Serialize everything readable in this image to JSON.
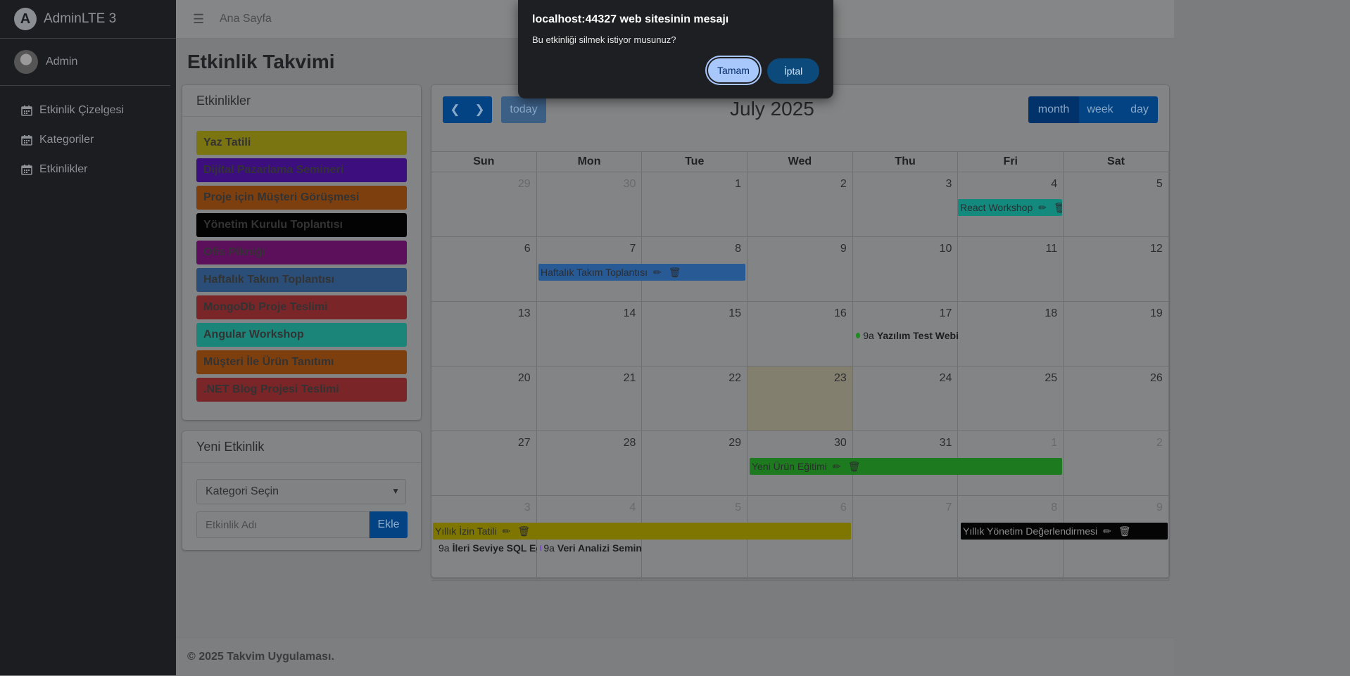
{
  "sidebar": {
    "brand": "AdminLTE 3",
    "user": "Admin",
    "items": [
      {
        "label": "Etkinlik Çizelgesi",
        "icon": "calendar-icon"
      },
      {
        "label": "Kategoriler",
        "icon": "calendar-icon"
      },
      {
        "label": "Etkinlikler",
        "icon": "calendar-icon"
      }
    ]
  },
  "topbar": {
    "home_link": "Ana Sayfa"
  },
  "page_title": "Etkinlik Takvimi",
  "events_panel": {
    "title": "Etkinlikler",
    "items": [
      {
        "label": "Yaz Tatili",
        "color": "#7a7411"
      },
      {
        "label": "Dijital Pazarlama Semineri",
        "color": "#3c0e7e"
      },
      {
        "label": "Proje için Müşteri Görüşmesi",
        "color": "#7e3f0f"
      },
      {
        "label": "Yönetim Kurulu Toplantısı",
        "color": "#030303"
      },
      {
        "label": "Ofis Pikniği",
        "color": "#5c105c"
      },
      {
        "label": "Haftalık Takım Toplantısı",
        "color": "#2a4e78"
      },
      {
        "label": "MongoDb Proje Teslimi",
        "color": "#7a2528"
      },
      {
        "label": "Angular Workshop",
        "color": "#1c857a"
      },
      {
        "label": "Müşteri İle Ürün Tanıtımı",
        "color": "#7e3f0f"
      },
      {
        "label": ".NET Blog Projesi Teslimi",
        "color": "#7a2528"
      }
    ]
  },
  "new_event": {
    "title": "Yeni Etkinlik",
    "category_placeholder": "Kategori Seçin",
    "name_placeholder": "Etkinlik Adı",
    "add_label": "Ekle"
  },
  "calendar": {
    "title": "July 2025",
    "today_label": "today",
    "views": {
      "month": "month",
      "week": "week",
      "day": "day"
    },
    "days_of_week": [
      "Sun",
      "Mon",
      "Tue",
      "Wed",
      "Thu",
      "Fri",
      "Sat"
    ],
    "weeks": [
      [
        {
          "d": "29",
          "o": true
        },
        {
          "d": "30",
          "o": true
        },
        {
          "d": "1"
        },
        {
          "d": "2"
        },
        {
          "d": "3"
        },
        {
          "d": "4"
        },
        {
          "d": "5"
        }
      ],
      [
        {
          "d": "6"
        },
        {
          "d": "7"
        },
        {
          "d": "8"
        },
        {
          "d": "9"
        },
        {
          "d": "10"
        },
        {
          "d": "11"
        },
        {
          "d": "12"
        }
      ],
      [
        {
          "d": "13"
        },
        {
          "d": "14"
        },
        {
          "d": "15"
        },
        {
          "d": "16"
        },
        {
          "d": "17"
        },
        {
          "d": "18"
        },
        {
          "d": "19"
        }
      ],
      [
        {
          "d": "20"
        },
        {
          "d": "21"
        },
        {
          "d": "22"
        },
        {
          "d": "23",
          "today": true
        },
        {
          "d": "24"
        },
        {
          "d": "25"
        },
        {
          "d": "26"
        }
      ],
      [
        {
          "d": "27"
        },
        {
          "d": "28"
        },
        {
          "d": "29"
        },
        {
          "d": "30"
        },
        {
          "d": "31"
        },
        {
          "d": "1",
          "o": true
        },
        {
          "d": "2",
          "o": true
        }
      ],
      [
        {
          "d": "3",
          "o": true
        },
        {
          "d": "4",
          "o": true
        },
        {
          "d": "5",
          "o": true
        },
        {
          "d": "6",
          "o": true
        },
        {
          "d": "7",
          "o": true
        },
        {
          "d": "8",
          "o": true
        },
        {
          "d": "9",
          "o": true
        }
      ]
    ],
    "events": {
      "react": "React Workshop",
      "weekly": "Haftalık Takım Toplantısı",
      "test_time": "9a",
      "test": "Yazılım Test Webi",
      "product": "Yeni Ürün Eğitimi",
      "annual_leave": "Yıllık İzin Tatili",
      "review": "Yıllık Yönetim Değerlendirmesi",
      "sql_time": "9a",
      "sql": "İleri Seviye SQL Eğ",
      "data_time": "9a",
      "data": "Veri Analizi Semin"
    },
    "colors": {
      "react": "#148a7e",
      "weekly": "#285a95",
      "product": "#1e7a1e",
      "annual_leave": "#7e7600",
      "review": "#050505",
      "test_dot": "#1f8a1f",
      "sql_dot": "#1f8a1f",
      "data_dot": "#5b2aa8"
    }
  },
  "footer": "© 2025 Takvim Uygulaması.",
  "dialog": {
    "title": "localhost:44327 web sitesinin mesajı",
    "message": "Bu etkinliği silmek istiyor musunuz?",
    "ok_label": "Tamam",
    "cancel_label": "İptal"
  }
}
